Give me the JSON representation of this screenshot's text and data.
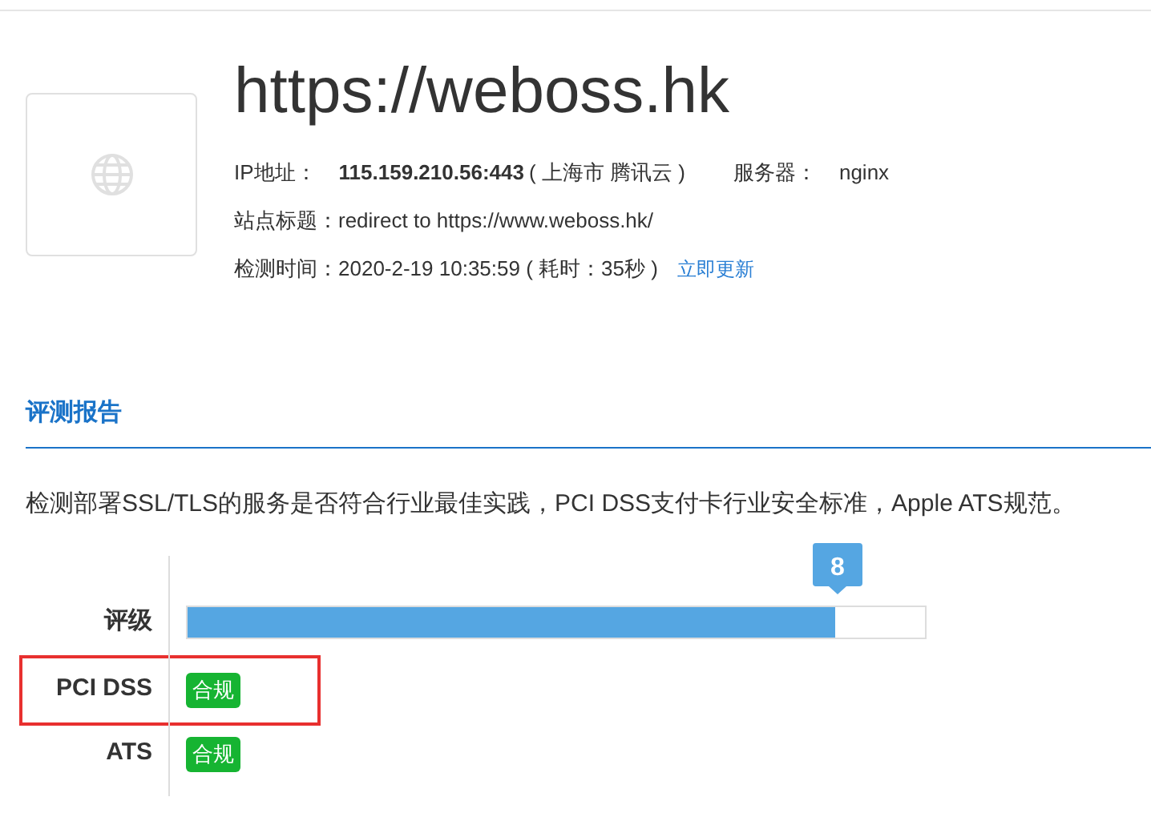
{
  "site": {
    "url": "https://weboss.hk",
    "ip_label": "IP地址：",
    "ip": "115.159.210.56:443",
    "location": "( 上海市 腾讯云 )",
    "server_label": "服务器：",
    "server": "nginx",
    "title_label": "站点标题：",
    "title": "redirect to https://www.weboss.hk/",
    "time_label": "检测时间：",
    "time": "2020-2-19 10:35:59 ( 耗时：35秒 )",
    "refresh": "立即更新"
  },
  "report": {
    "heading": "评测报告",
    "description": "检测部署SSL/TLS的服务是否符合行业最佳实践，PCI DSS支付卡行业安全标准，Apple ATS规范。",
    "rows": [
      {
        "kind": "grade",
        "label": "评级",
        "score": "8",
        "level": 0.878,
        "highlighted": false
      },
      {
        "kind": "badge",
        "label": "PCI DSS",
        "badge": "合规",
        "highlighted": true
      },
      {
        "kind": "badge",
        "label": "ATS",
        "badge": "合规",
        "highlighted": false
      }
    ]
  }
}
